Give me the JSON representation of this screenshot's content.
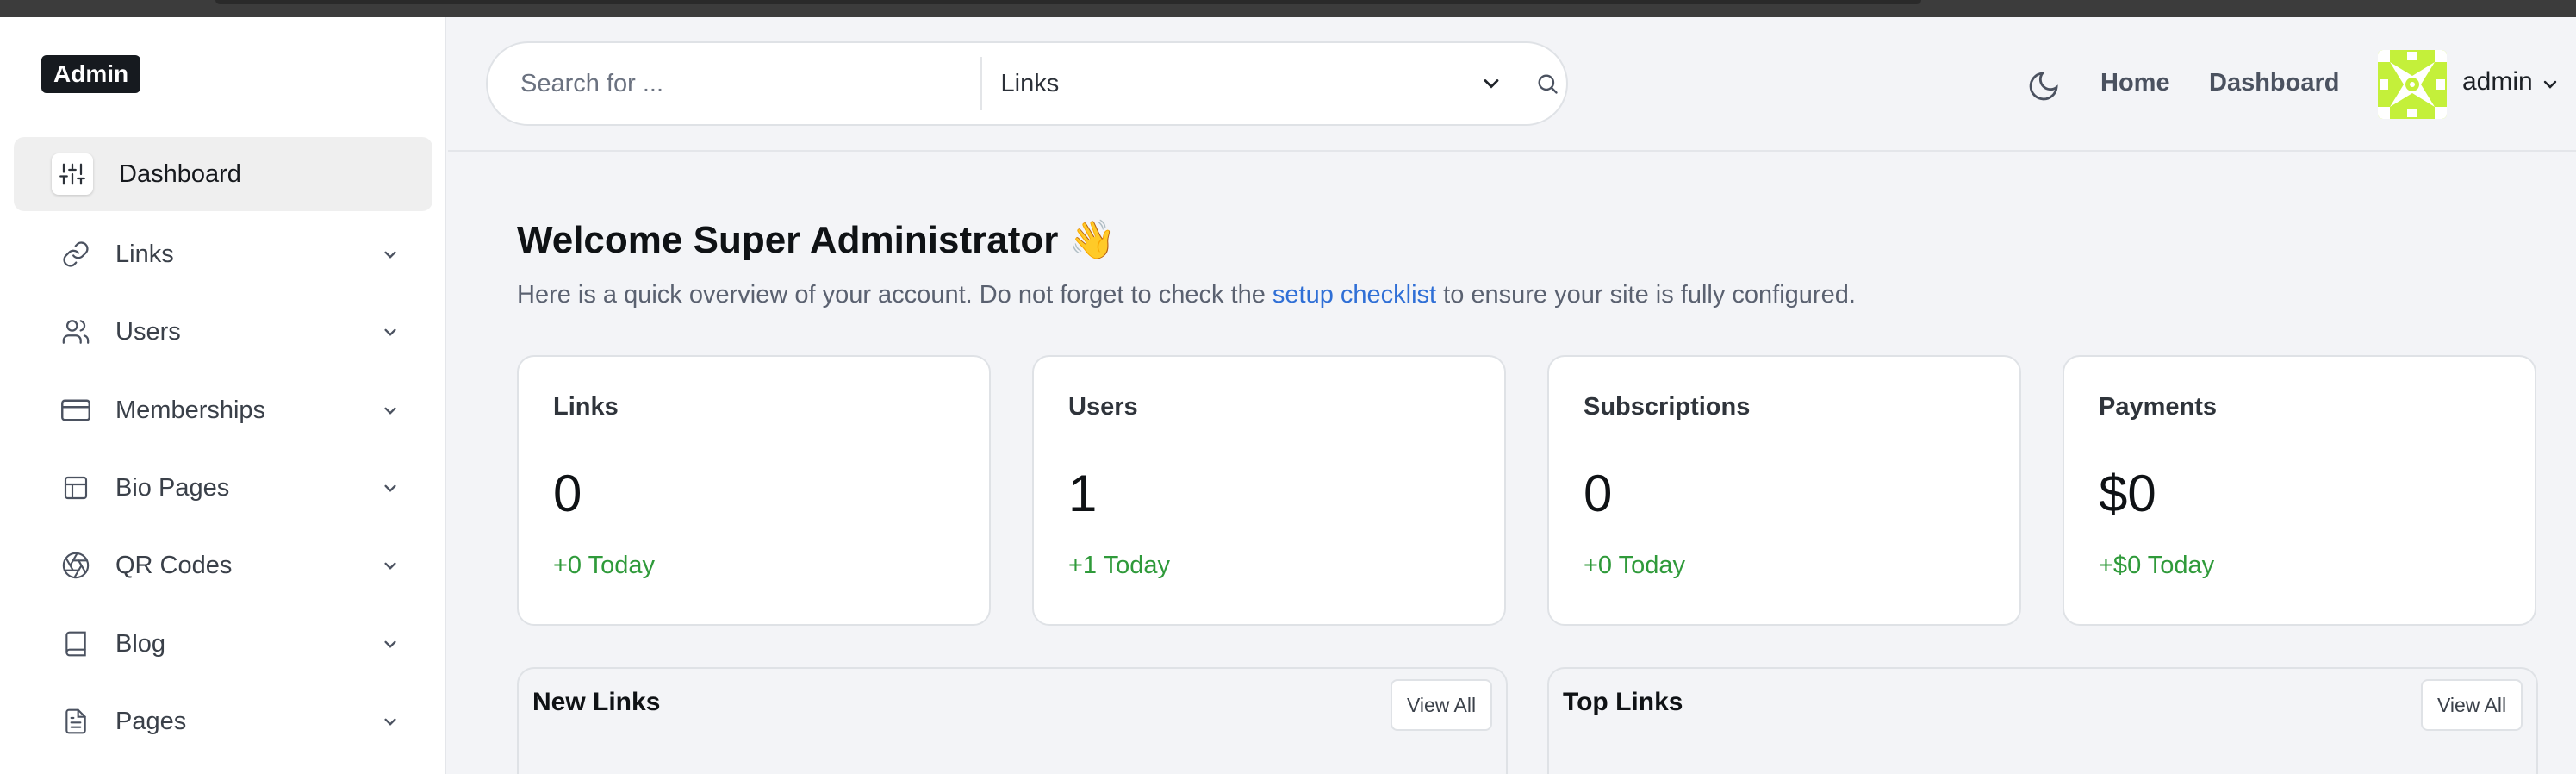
{
  "sidebar": {
    "logo": "Admin",
    "items": [
      {
        "label": "Dashboard",
        "icon": "sliders-icon",
        "active": true
      },
      {
        "label": "Links",
        "icon": "link-icon"
      },
      {
        "label": "Users",
        "icon": "users-icon"
      },
      {
        "label": "Memberships",
        "icon": "credit-card-icon"
      },
      {
        "label": "Bio Pages",
        "icon": "layout-icon"
      },
      {
        "label": "QR Codes",
        "icon": "aperture-icon"
      },
      {
        "label": "Blog",
        "icon": "book-icon"
      },
      {
        "label": "Pages",
        "icon": "file-text-icon"
      }
    ]
  },
  "header": {
    "search_placeholder": "Search for ...",
    "search_scope": "Links",
    "links": [
      "Home",
      "Dashboard"
    ],
    "user_name": "admin"
  },
  "welcome": {
    "title": "Welcome Super Administrator 👋",
    "text_before": "Here is a quick overview of your account. Do not forget to check the ",
    "link": "setup checklist",
    "text_after": " to ensure your site is fully configured."
  },
  "stats": [
    {
      "title": "Links",
      "value": "0",
      "delta": "+0 Today"
    },
    {
      "title": "Users",
      "value": "1",
      "delta": "+1 Today"
    },
    {
      "title": "Subscriptions",
      "value": "0",
      "delta": "+0 Today"
    },
    {
      "title": "Payments",
      "value": "$0",
      "delta": "+$0 Today"
    }
  ],
  "panels": [
    {
      "title": "New Links",
      "button": "View All"
    },
    {
      "title": "Top Links",
      "button": "View All"
    }
  ],
  "colors": {
    "accent_link": "#2f6fd6",
    "positive": "#2f9a3a",
    "avatar": "#c4f03a",
    "logo_bg": "#161a1f"
  }
}
